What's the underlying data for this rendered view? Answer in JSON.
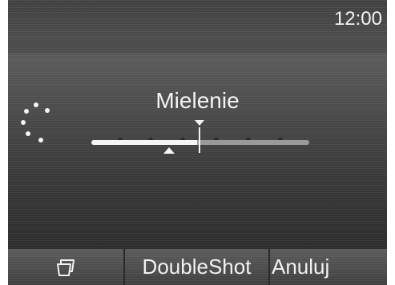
{
  "status_bar": {
    "time": "12:00"
  },
  "main": {
    "title": "Mielenie",
    "grind_level_fraction": 0.49
  },
  "softkeys": [
    {
      "icon": "cup-icon",
      "label": ""
    },
    {
      "label": "DoubleShot"
    },
    {
      "label": "Anuluj"
    }
  ],
  "colors": {
    "text": "#f4f4f4",
    "background": "#3d3d3d",
    "track_inactive": "#9a9a9a"
  }
}
